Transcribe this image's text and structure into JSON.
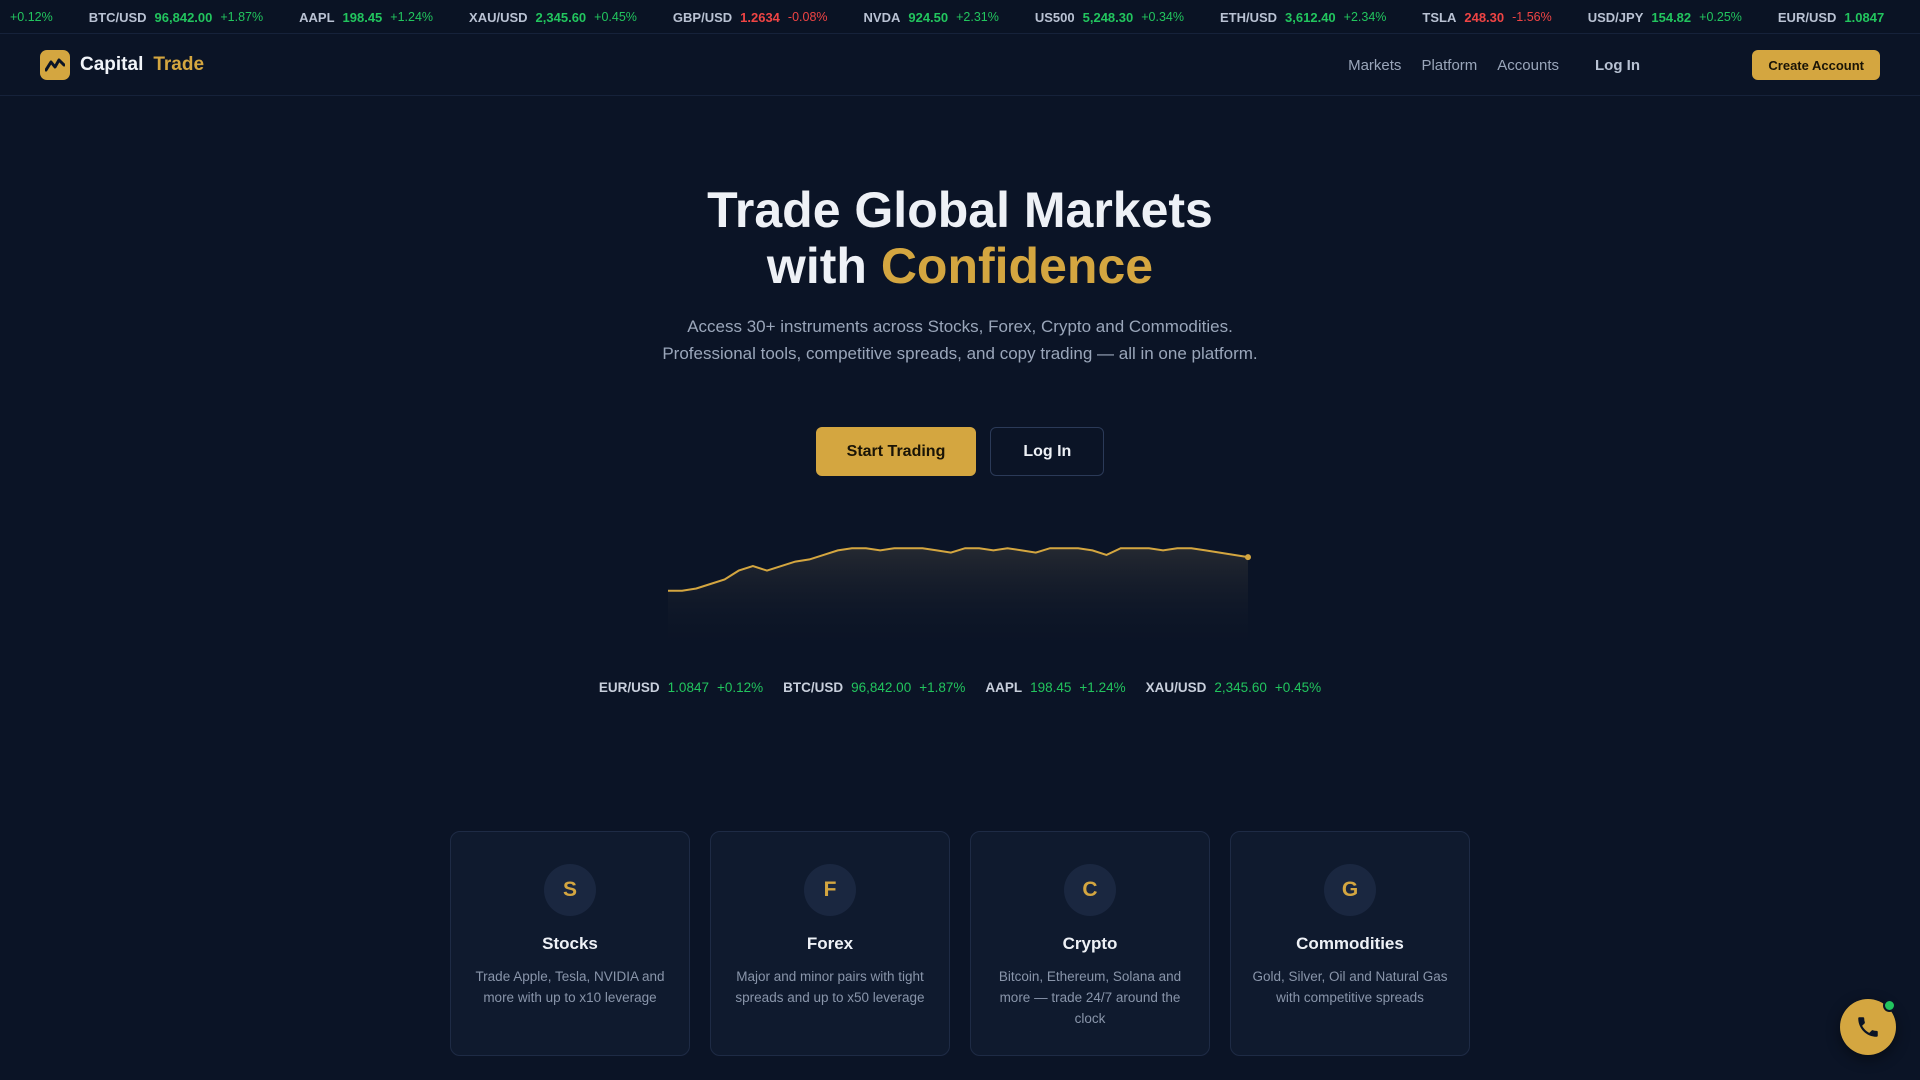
{
  "ticker": [
    {
      "symbol": "",
      "price": "",
      "change": "+0.12%",
      "dir": "up"
    },
    {
      "symbol": "BTC/USD",
      "price": "96,842.00",
      "change": "+1.87%",
      "dir": "up"
    },
    {
      "symbol": "AAPL",
      "price": "198.45",
      "change": "+1.24%",
      "dir": "up"
    },
    {
      "symbol": "XAU/USD",
      "price": "2,345.60",
      "change": "+0.45%",
      "dir": "up"
    },
    {
      "symbol": "GBP/USD",
      "price": "1.2634",
      "change": "-0.08%",
      "dir": "down"
    },
    {
      "symbol": "NVDA",
      "price": "924.50",
      "change": "+2.31%",
      "dir": "up"
    },
    {
      "symbol": "US500",
      "price": "5,248.30",
      "change": "+0.34%",
      "dir": "up"
    },
    {
      "symbol": "ETH/USD",
      "price": "3,612.40",
      "change": "+2.34%",
      "dir": "up"
    },
    {
      "symbol": "TSLA",
      "price": "248.30",
      "change": "-1.56%",
      "dir": "down"
    },
    {
      "symbol": "USD/JPY",
      "price": "154.82",
      "change": "+0.25%",
      "dir": "up"
    },
    {
      "symbol": "EUR/USD",
      "price": "1.0847",
      "change": "",
      "dir": "up"
    }
  ],
  "header": {
    "logo_primary": "Capital",
    "logo_secondary": "Trade",
    "nav": [
      "Markets",
      "Platform",
      "Accounts"
    ],
    "login_label": "Log In",
    "create_account_label": "Create Account"
  },
  "hero": {
    "title_line1": "Trade Global Markets",
    "title_line2_prefix": "with",
    "title_line2_accent": "Confidence",
    "subtitle": "Access 30+ instruments across Stocks, Forex, Crypto and Commodities. Professional tools, competitive spreads, and copy trading — all in one platform.",
    "cta_primary": "Start Trading",
    "cta_secondary": "Log In"
  },
  "chart_series": [
    22,
    22,
    23,
    25,
    27,
    31,
    33,
    31,
    33,
    35,
    36,
    38,
    40,
    41,
    41,
    40,
    41,
    41,
    41,
    40,
    39,
    41,
    41,
    40,
    41,
    40,
    39,
    41,
    41,
    41,
    40,
    38,
    41,
    41,
    41,
    40,
    41,
    41,
    40,
    39,
    38,
    37
  ],
  "quotes": [
    {
      "symbol": "EUR/USD",
      "price": "1.0847",
      "change": "+0.12%"
    },
    {
      "symbol": "BTC/USD",
      "price": "96,842.00",
      "change": "+1.87%"
    },
    {
      "symbol": "AAPL",
      "price": "198.45",
      "change": "+1.24%"
    },
    {
      "symbol": "XAU/USD",
      "price": "2,345.60",
      "change": "+0.45%"
    }
  ],
  "markets": [
    {
      "letter": "S",
      "title": "Stocks",
      "desc": "Trade Apple, Tesla, NVIDIA and more with up to x10 leverage"
    },
    {
      "letter": "F",
      "title": "Forex",
      "desc": "Major and minor pairs with tight spreads and up to x50 leverage"
    },
    {
      "letter": "C",
      "title": "Crypto",
      "desc": "Bitcoin, Ethereum, Solana and more — trade 24/7 around the clock"
    },
    {
      "letter": "G",
      "title": "Commodities",
      "desc": "Gold, Silver, Oil and Natural Gas with competitive spreads"
    }
  ],
  "colors": {
    "accent": "#d4a640",
    "up": "#22c55e",
    "down": "#ef4444",
    "background": "#0b1426"
  },
  "icons": {
    "logo": "chart-line-icon",
    "support": "phone-icon"
  }
}
